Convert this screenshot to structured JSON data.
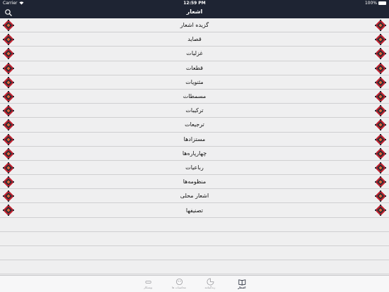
{
  "statusbar": {
    "carrier": "Carrier",
    "time": "12:59 PM",
    "battery": "100%"
  },
  "header": {
    "title": "اشعار"
  },
  "list": {
    "items": [
      "گزیده اشعار",
      "قصاید",
      "غزلیات",
      "قطعات",
      "مثنویات",
      "مسمطات",
      "ترکیبات",
      "ترجیعات",
      "مستزادها",
      "چهارپاره‌ها",
      "رباعیات",
      "منظومه‌ها",
      "اشعار محلی",
      "تصنیفها"
    ]
  },
  "tabs": [
    {
      "label": "ویسکار"
    },
    {
      "label": "محاسبات ها"
    },
    {
      "label": "زندگینامه"
    },
    {
      "label": "اشعار"
    }
  ],
  "colors": {
    "bar": "#1e2433",
    "ornament_red": "#c0212f",
    "ornament_dark": "#2a2a34"
  }
}
